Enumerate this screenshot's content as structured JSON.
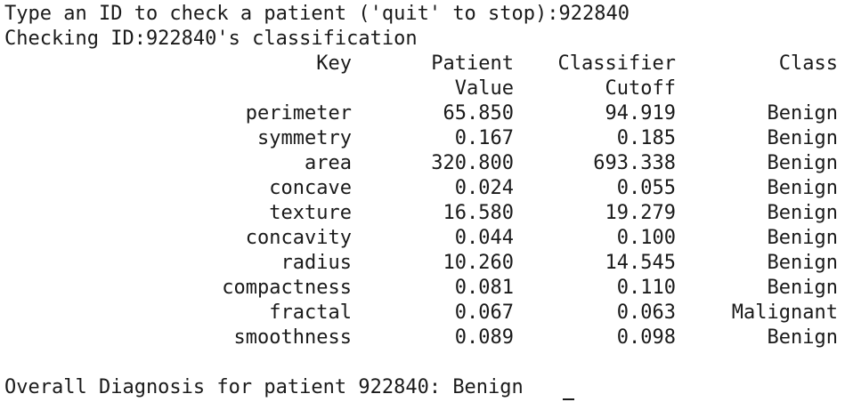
{
  "terminal": {
    "prompt_line": "Type an ID to check a patient ('quit' to stop):922840",
    "checking_line": "Checking ID:922840's classification",
    "headers": {
      "key": "Key",
      "value_top": "Patient",
      "value_bottom": "Value",
      "cutoff_top": "Classifier",
      "cutoff_bottom": "Cutoff",
      "class": "Class"
    },
    "rows": [
      {
        "key": "perimeter",
        "value": "65.850",
        "cutoff": "94.919",
        "class": "Benign"
      },
      {
        "key": "symmetry",
        "value": "0.167",
        "cutoff": "0.185",
        "class": "Benign"
      },
      {
        "key": "area",
        "value": "320.800",
        "cutoff": "693.338",
        "class": "Benign"
      },
      {
        "key": "concave",
        "value": "0.024",
        "cutoff": "0.055",
        "class": "Benign"
      },
      {
        "key": "texture",
        "value": "16.580",
        "cutoff": "19.279",
        "class": "Benign"
      },
      {
        "key": "concavity",
        "value": "0.044",
        "cutoff": "0.100",
        "class": "Benign"
      },
      {
        "key": "radius",
        "value": "10.260",
        "cutoff": "14.545",
        "class": "Benign"
      },
      {
        "key": "compactness",
        "value": "0.081",
        "cutoff": "0.110",
        "class": "Benign"
      },
      {
        "key": "fractal",
        "value": "0.067",
        "cutoff": "0.063",
        "class": "Malignant"
      },
      {
        "key": "smoothness",
        "value": "0.089",
        "cutoff": "0.098",
        "class": "Benign"
      }
    ],
    "overall_line": "Overall Diagnosis for patient 922840: Benign"
  }
}
